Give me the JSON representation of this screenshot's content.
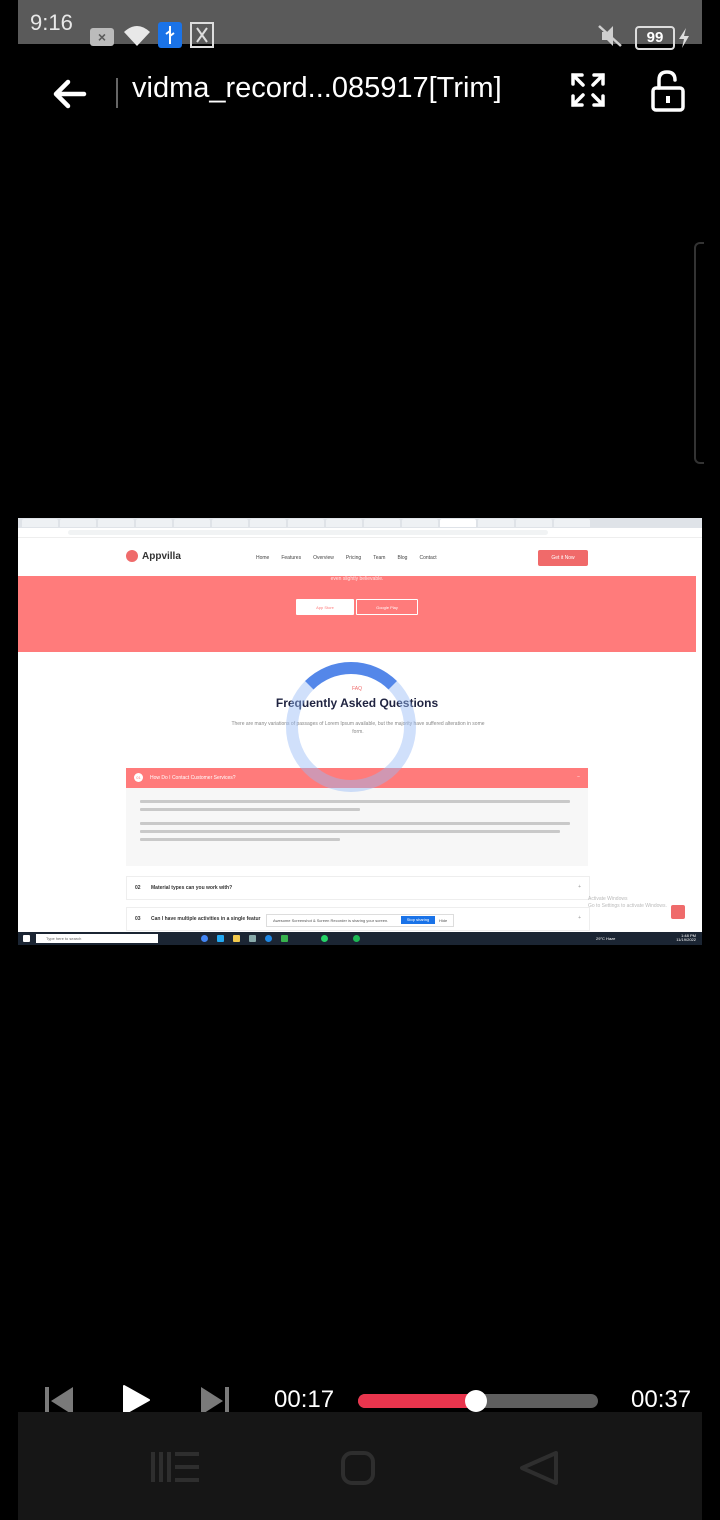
{
  "status_bar": {
    "time": "9:16",
    "battery": "99"
  },
  "header": {
    "title": "vidma_record...085917[Trim]"
  },
  "video_frame": {
    "logo": "Appvilla",
    "nav_links": [
      "Home",
      "Features",
      "Overview",
      "Pricing",
      "Team",
      "Blog",
      "Contact"
    ],
    "cta": "Get it Now",
    "hero_subtitle": "even slightly believable.",
    "app_store": "App Store",
    "google_play": "Google Play",
    "faq_tag": "FAQ",
    "faq_title": "Frequently Asked Questions",
    "faq_desc": "There are many variations of passages of Lorem Ipsum available, but the majority have suffered alteration in some form.",
    "faq_active": {
      "num": "01",
      "question": "How Do I Contact Customer Services?"
    },
    "faq_items": [
      {
        "num": "02",
        "question": "Material types can you work with?"
      },
      {
        "num": "03",
        "question": "Can I have multiple activities in a single featur"
      }
    ],
    "watermark": [
      "Activate Windows",
      "Go to Settings to activate Windows."
    ],
    "share_text": "Awesome Screenshot & Screen Recorder is sharing your screen.",
    "stop_sharing": "Stop sharing",
    "hide": "Hide",
    "taskbar_search": "Type here to search",
    "taskbar_weather": "29°C Haze",
    "taskbar_time": "1:48 PM",
    "taskbar_date": "11/19/2022"
  },
  "player": {
    "current_time": "00:17",
    "total_time": "00:37",
    "progress": 0.49
  },
  "colors": {
    "accent": "#e8354d",
    "site_brand": "#ff7b7b"
  }
}
